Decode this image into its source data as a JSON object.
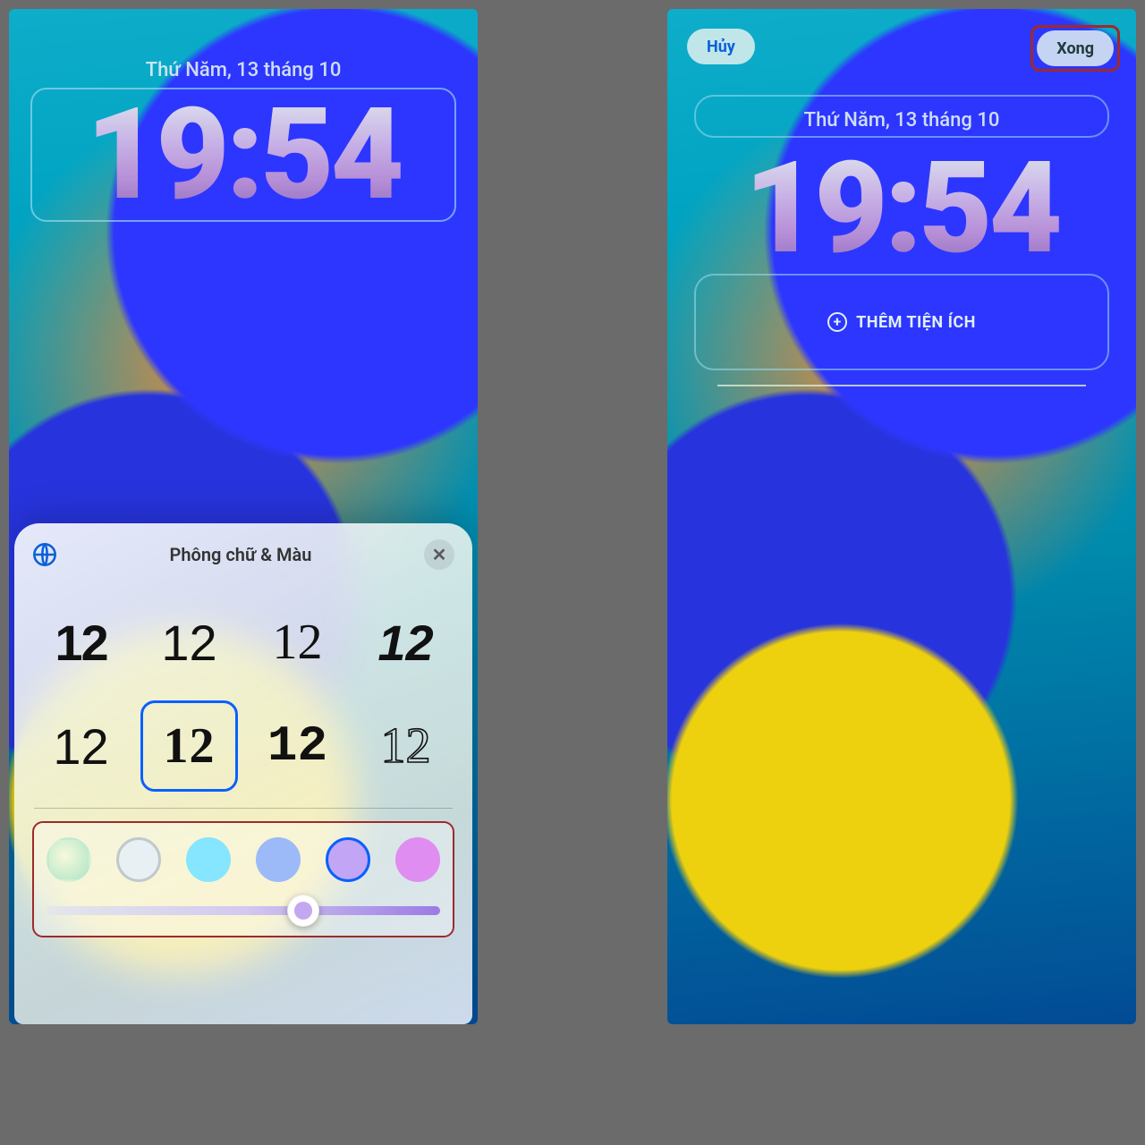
{
  "lockscreen": {
    "date": "Thứ Năm, 13 tháng 10",
    "time": "19:54"
  },
  "font_sheet": {
    "title": "Phông chữ & Màu",
    "sample": "12",
    "selected_font_index": 5,
    "fonts": [
      "12",
      "12",
      "12",
      "12",
      "12",
      "12",
      "12",
      "12"
    ],
    "selected_color_index": 4,
    "slider_percent": 65,
    "colors": [
      "gradient-green",
      "#e9f0f3",
      "#86e5ff",
      "#9cbaf8",
      "#c2a6f5",
      "#e08df2"
    ]
  },
  "editor": {
    "cancel_label": "Hủy",
    "done_label": "Xong",
    "add_widget_label": "THÊM TIỆN ÍCH"
  }
}
